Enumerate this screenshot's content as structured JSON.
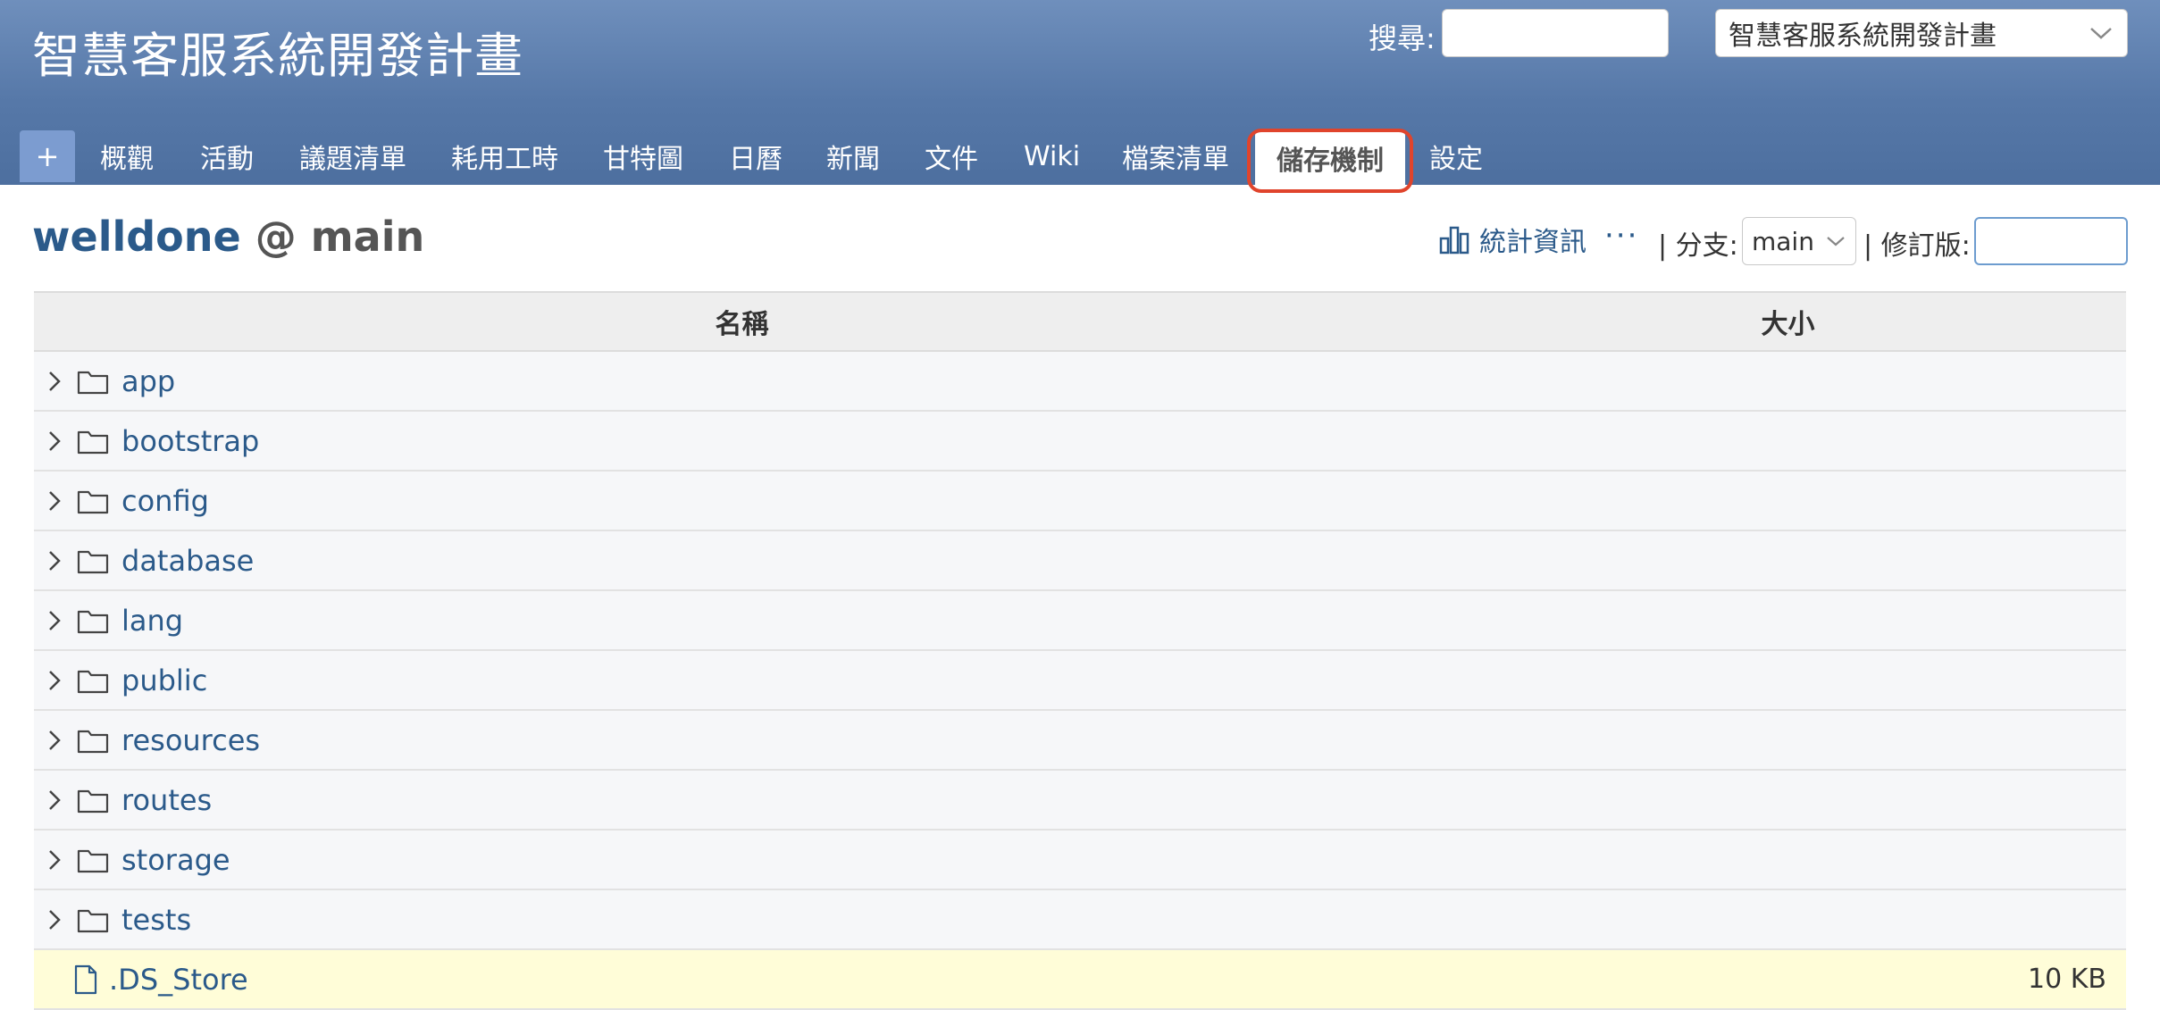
{
  "header": {
    "project_title": "智慧客服系統開發計畫",
    "search_label": "搜尋:",
    "search_value": "",
    "project_select": "智慧客服系統開發計畫"
  },
  "tabs": {
    "add": "+",
    "items": [
      {
        "label": "概觀"
      },
      {
        "label": "活動"
      },
      {
        "label": "議題清單"
      },
      {
        "label": "耗用工時"
      },
      {
        "label": "甘特圖"
      },
      {
        "label": "日曆"
      },
      {
        "label": "新聞"
      },
      {
        "label": "文件"
      },
      {
        "label": "Wiki"
      },
      {
        "label": "檔案清單"
      },
      {
        "label": "儲存機制"
      },
      {
        "label": "設定"
      }
    ],
    "active": "儲存機制"
  },
  "repo": {
    "name": "welldone",
    "branch_suffix": "@ main",
    "stats_label": "統計資訊",
    "more": "···",
    "branch_label": "| 分支:",
    "branch_value": "main",
    "rev_label": "| 修訂版:",
    "rev_value": ""
  },
  "table": {
    "columns": [
      "名稱",
      "大小"
    ],
    "entries": [
      {
        "name": "app",
        "type": "dir",
        "size": ""
      },
      {
        "name": "bootstrap",
        "type": "dir",
        "size": ""
      },
      {
        "name": "config",
        "type": "dir",
        "size": ""
      },
      {
        "name": "database",
        "type": "dir",
        "size": ""
      },
      {
        "name": "lang",
        "type": "dir",
        "size": ""
      },
      {
        "name": "public",
        "type": "dir",
        "size": ""
      },
      {
        "name": "resources",
        "type": "dir",
        "size": ""
      },
      {
        "name": "routes",
        "type": "dir",
        "size": ""
      },
      {
        "name": "storage",
        "type": "dir",
        "size": ""
      },
      {
        "name": "tests",
        "type": "dir",
        "size": ""
      },
      {
        "name": ".DS_Store",
        "type": "file",
        "size": "10 KB"
      }
    ]
  },
  "colors": {
    "header_top": "#6f8fbc",
    "header_bottom": "#4d6f9f",
    "link": "#2b5a8a",
    "active_highlight": "#e0442c",
    "file_row_bg": "#fffdd8"
  }
}
